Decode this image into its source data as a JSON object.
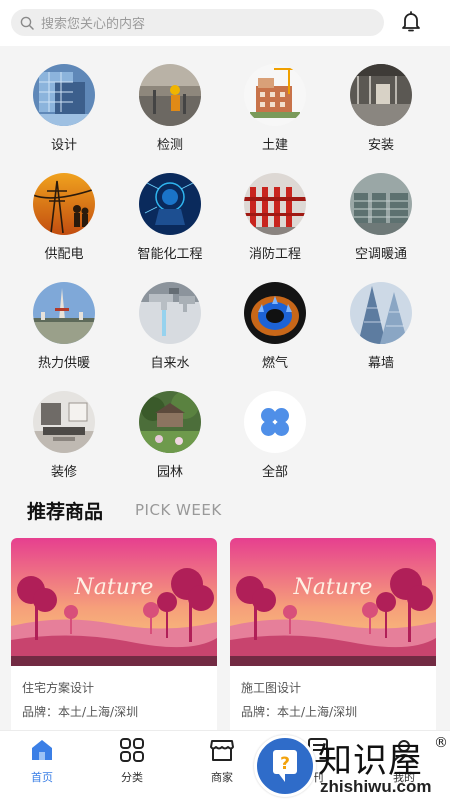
{
  "search": {
    "placeholder": "搜索您关心的内容"
  },
  "categories": [
    {
      "label": "设计",
      "icon": "design-photo"
    },
    {
      "label": "检测",
      "icon": "inspection-photo"
    },
    {
      "label": "土建",
      "icon": "civil-construction-photo"
    },
    {
      "label": "安装",
      "icon": "installation-photo"
    },
    {
      "label": "供配电",
      "icon": "power-supply-photo"
    },
    {
      "label": "智能化工程",
      "icon": "intelligent-engineering-photo"
    },
    {
      "label": "消防工程",
      "icon": "fire-protection-photo"
    },
    {
      "label": "空调暖通",
      "icon": "hvac-photo"
    },
    {
      "label": "热力供暖",
      "icon": "heating-photo"
    },
    {
      "label": "自来水",
      "icon": "tap-water-photo"
    },
    {
      "label": "燃气",
      "icon": "gas-flame-photo"
    },
    {
      "label": "幕墙",
      "icon": "curtain-wall-photo"
    },
    {
      "label": "装修",
      "icon": "decoration-photo"
    },
    {
      "label": "园林",
      "icon": "garden-photo"
    },
    {
      "label": "全部",
      "icon": "all-grid-icon"
    }
  ],
  "recommend": {
    "title": "推荐商品",
    "subtitle": "PICK WEEK"
  },
  "products": [
    {
      "name": "住宅方案设计",
      "brand": "品牌：本土/上海/深圳",
      "image_text": "Nature"
    },
    {
      "name": "施工图设计",
      "brand": "品牌：本土/上海/深圳",
      "image_text": "Nature"
    }
  ],
  "tabs": [
    {
      "label": "首页",
      "icon": "home-icon",
      "active": true
    },
    {
      "label": "分类",
      "icon": "category-icon",
      "active": false
    },
    {
      "label": "商家",
      "icon": "store-icon",
      "active": false
    },
    {
      "label": "刊",
      "icon": "journal-icon",
      "active": false
    },
    {
      "label": "我的",
      "icon": "profile-icon",
      "active": false
    }
  ],
  "watermark": {
    "chinese": "知识屋",
    "domain": "zhishiwu.com",
    "registered": "®"
  },
  "colors": {
    "accent": "#3b7fe6",
    "watermark_blue": "#2f6cc9"
  }
}
